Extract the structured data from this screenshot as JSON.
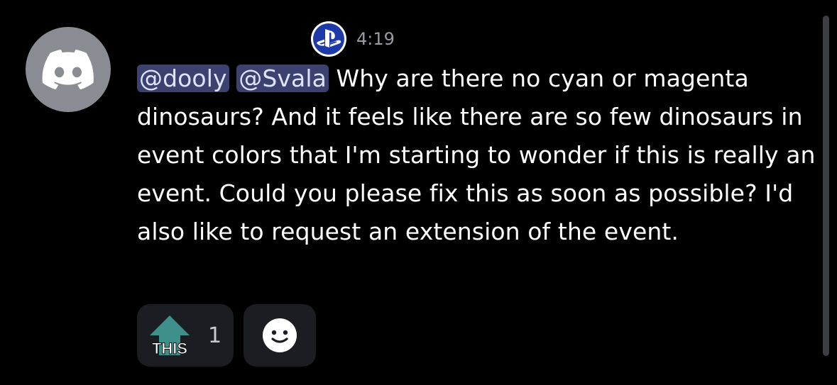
{
  "post": {
    "timestamp": "4:19",
    "mentions": [
      "@dooly",
      "@Svala"
    ],
    "body": "Why are there no cyan or magenta dinosaurs? And it feels like there are so few dinosaurs in event colors that I'm starting to wonder if this is really an event. Could you please fix this as soon as possible? I'd also like to request an extension of the event."
  },
  "reactions": [
    {
      "emoji_text": "THIS",
      "icon": "this-arrow-emoji",
      "count": "1"
    }
  ],
  "icons": {
    "avatar": "discord-logo-icon",
    "badge": "playstation-logo-icon",
    "add_reaction": "smiley-face-icon"
  },
  "colors": {
    "background": "#000000",
    "avatar_bg": "#8a8c93",
    "mention_bg": "#3c4270",
    "mention_text": "#dfe3ff",
    "reaction_bg": "#1c1d22",
    "this_emoji_teal": "#3f8f8b"
  }
}
